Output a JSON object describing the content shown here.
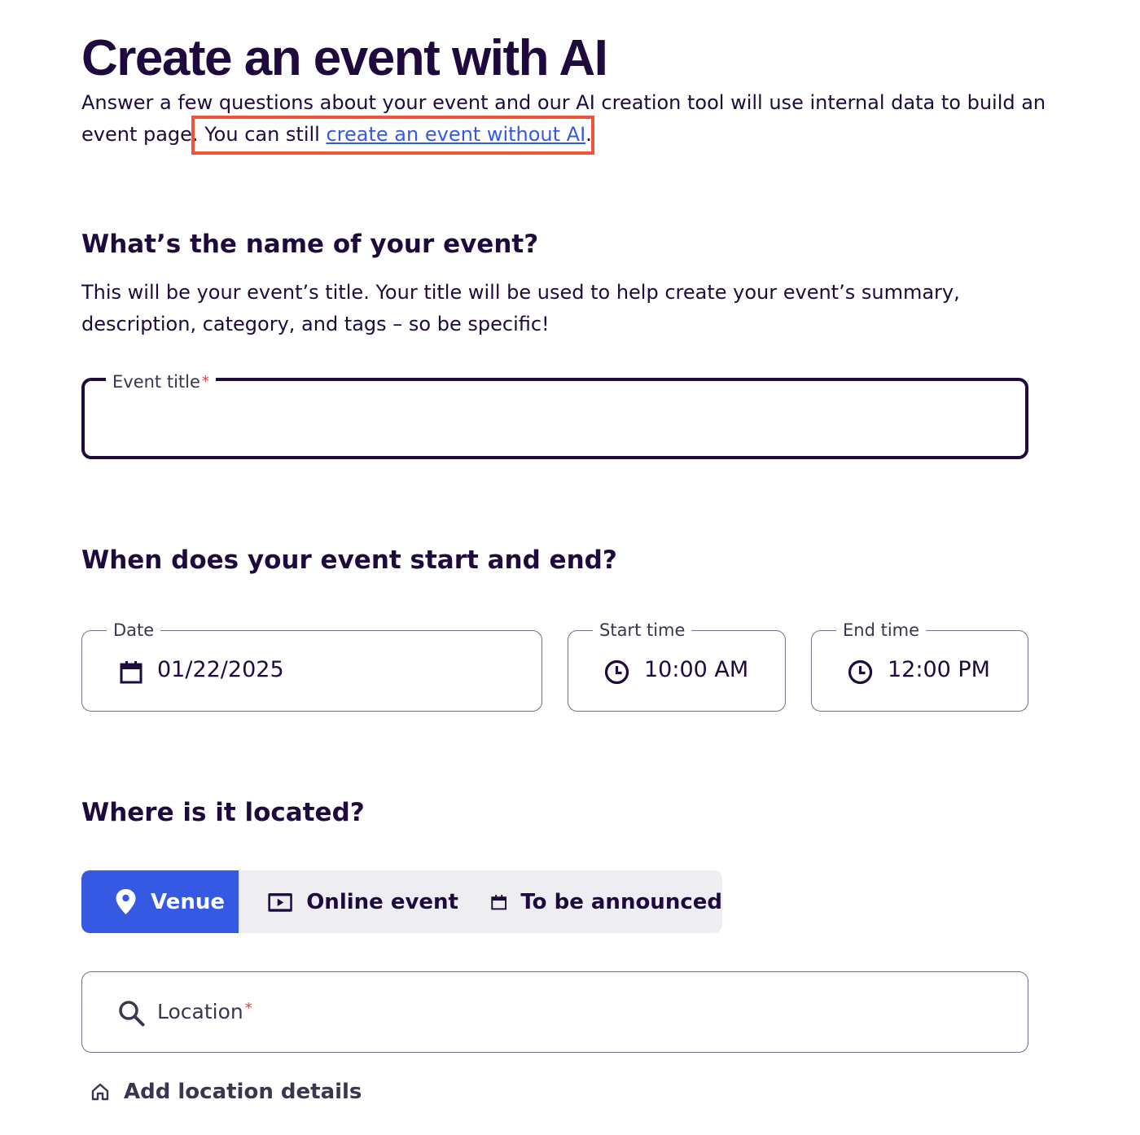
{
  "page": {
    "title": "Create an event with AI",
    "intro_line1": "Answer a few questions about your event and our AI creation tool will use internal data to build an",
    "intro_line2_prefix": "event page.",
    "intro_line2_still": " You can still ",
    "intro_link": "create an event without AI",
    "intro_line2_suffix": "."
  },
  "name_section": {
    "heading": "What’s the name of your event?",
    "desc_line1": "This will be your event’s title. Your title will be used to help create your event’s summary,",
    "desc_line2": "description, category, and tags – so be specific!",
    "field_label": "Event title",
    "required_mark": "*",
    "value": ""
  },
  "time_section": {
    "heading": "When does your event start and end?",
    "date": {
      "label": "Date",
      "value": "01/22/2025",
      "icon": "calendar-icon"
    },
    "start": {
      "label": "Start time",
      "value": "10:00 AM",
      "icon": "clock-icon"
    },
    "end": {
      "label": "End time",
      "value": "12:00 PM",
      "icon": "clock-icon"
    }
  },
  "location_section": {
    "heading": "Where is it located?",
    "options": [
      {
        "label": "Venue",
        "icon": "map-pin-icon",
        "active": true
      },
      {
        "label": "Online event",
        "icon": "video-icon",
        "active": false
      },
      {
        "label": "To be announced",
        "icon": "calendar-icon",
        "active": false
      }
    ],
    "location_placeholder": "Location",
    "required_mark": "*",
    "add_details": "Add location details"
  },
  "colors": {
    "primary_text": "#1e0a3c",
    "accent_blue": "#3659e3",
    "highlight_orange": "#f05537",
    "required_red": "#e03a3a"
  }
}
